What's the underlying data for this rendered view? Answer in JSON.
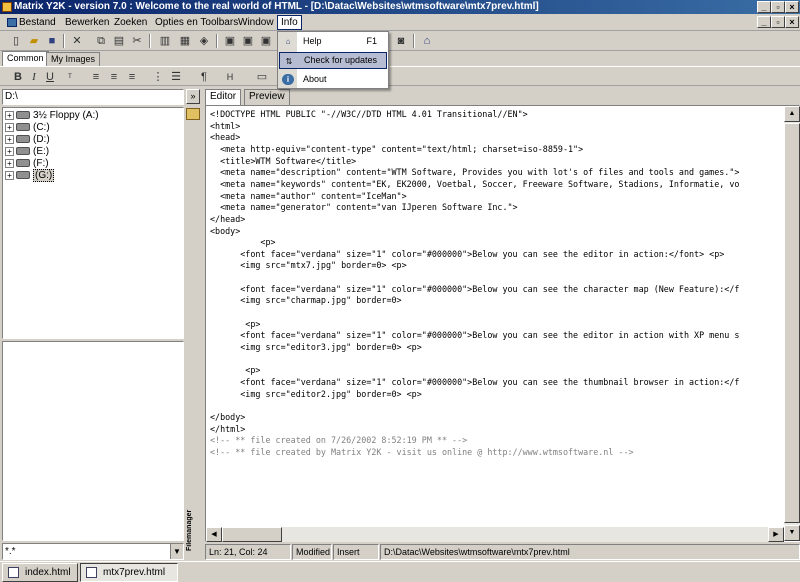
{
  "window": {
    "title": "Matrix Y2K - version 7.0 : Welcome to the real world of HTML - [D:\\Datac\\Websites\\wtmsoftware\\mtx7prev.html]"
  },
  "menubar": [
    "Bestand",
    "Bewerken",
    "Zoeken",
    "Opties en Toolbars",
    "Window",
    "Info"
  ],
  "info_menu": {
    "items": [
      {
        "label": "Help",
        "shortcut": "F1",
        "icon": "help-book-icon"
      },
      {
        "label": "Check for updates",
        "shortcut": "",
        "icon": "update-icon"
      },
      {
        "label": "About",
        "shortcut": "",
        "icon": "info-icon"
      }
    ],
    "highlighted": "Check for updates"
  },
  "toolbar_tabs": [
    "Common",
    "My Images"
  ],
  "left_panel": {
    "path": "D:\\",
    "drives": [
      "3½ Floppy (A:)",
      "(C:)",
      "(D:)",
      "(E:)",
      "(F:)",
      "(G:)"
    ],
    "selected_drive": "(G:)",
    "filter": "*.*",
    "side_label": "Filemanager"
  },
  "editor": {
    "tabs": [
      "Editor",
      "Preview"
    ],
    "active_tab": "Editor",
    "lines": [
      "<!DOCTYPE HTML PUBLIC \"-//W3C//DTD HTML 4.01 Transitional//EN\">",
      "<html>",
      "<head>",
      "  <meta http-equiv=\"content-type\" content=\"text/html; charset=iso-8859-1\">",
      "  <title>WTM Software</title>",
      "  <meta name=\"description\" content=\"WTM Software, Provides you with lot's of files and tools and games.\">",
      "  <meta name=\"keywords\" content=\"EK, EK2000, Voetbal, Soccer, Freeware Software, Stadions, Informatie, vo",
      "  <meta name=\"author\" content=\"IceMan\">",
      "  <meta name=\"generator\" content=\"van IJperen Software Inc.\">",
      "</head>",
      "<body>",
      "          <p>",
      "      <font face=\"verdana\" size=\"1\" color=\"#000000\">Below you can see the editor in action:</font> <p>",
      "      <img src=\"mtx7.jpg\" border=0> <p>",
      "",
      "      <font face=\"verdana\" size=\"1\" color=\"#000000\">Below you can see the character map (New Feature):</f",
      "      <img src=\"charmap.jpg\" border=0>",
      "",
      "       <p>",
      "      <font face=\"verdana\" size=\"1\" color=\"#000000\">Below you can see the editor in action with XP menu s",
      "      <img src=\"editor3.jpg\" border=0> <p>",
      "",
      "       <p>",
      "      <font face=\"verdana\" size=\"1\" color=\"#000000\">Below you can see the thumbnail browser in action:</f",
      "      <img src=\"editor2.jpg\" border=0> <p>",
      "",
      "</body>",
      "</html>",
      "<!-- ** file created on 7/26/2002 8:52:19 PM ** -->",
      "<!-- ** file created by Matrix Y2K - visit us online @ http://www.wtmsoftware.nl -->"
    ],
    "comment_color": "#808080"
  },
  "statusbar": {
    "position": "Ln:   21, Col: 24",
    "state": "Modified",
    "mode": "Insert",
    "file": "D:\\Datac\\Websites\\wtmsoftware\\mtx7prev.html"
  },
  "document_tabs": [
    {
      "label": "index.html"
    },
    {
      "label": "mtx7prev.html"
    }
  ],
  "active_document": "mtx7prev.html",
  "colors": {
    "titlebar_start": "#0a246a",
    "titlebar_end": "#3a6ea5",
    "menu_highlight": "#b6bdd2"
  }
}
